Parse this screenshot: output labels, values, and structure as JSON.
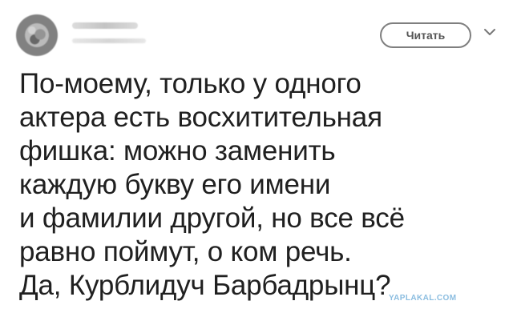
{
  "tweet": {
    "follow_label": "Читать",
    "text": "По-моему, только у одного\nактера есть восхитительная\nфишка: можно заменить\nкаждую букву его имени\nи фамилии другой, но все всё\nравно поймут, о ком речь.\nДа, Курблидуч Барбадрынц?",
    "watermark": "YAPLAKAL.COM"
  },
  "icons": {
    "dropdown": "chevron-down-icon"
  }
}
